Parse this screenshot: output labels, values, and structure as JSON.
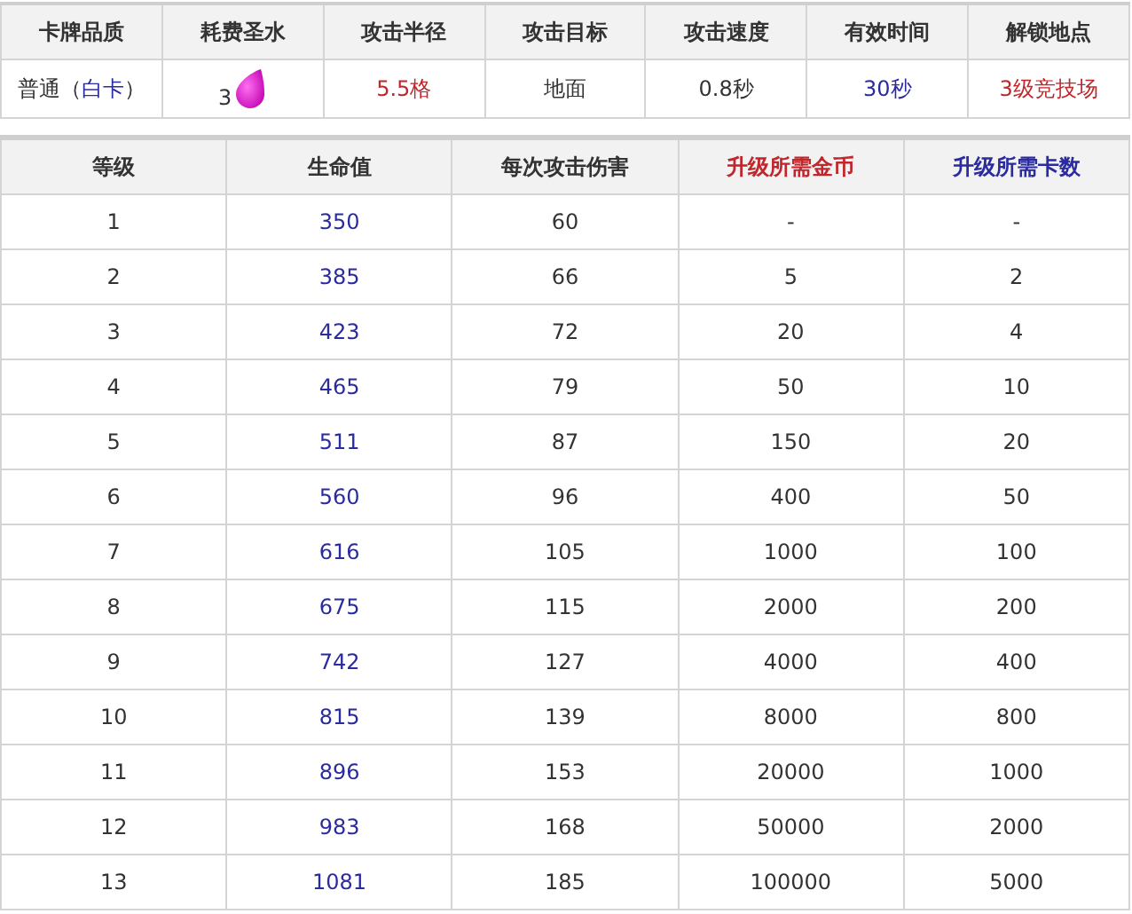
{
  "card_info": {
    "headers": [
      "卡牌品质",
      "耗费圣水",
      "攻击半径",
      "攻击目标",
      "攻击速度",
      "有效时间",
      "解锁地点"
    ],
    "quality": {
      "before": "普通（",
      "highlight": "白卡",
      "after": "）"
    },
    "cost": "3",
    "stats": [
      {
        "text": "5.5格",
        "color": "#c0262b"
      },
      {
        "text": "地面",
        "color": "#333333"
      },
      {
        "text": "0.8秒",
        "color": "#333333"
      },
      {
        "text": "30秒",
        "color": "#2b2ba0"
      },
      {
        "text": "3级竞技场",
        "color": "#c0262b"
      }
    ]
  },
  "levels": {
    "columns": [
      {
        "label": "等级",
        "color": "#333333"
      },
      {
        "label": "生命值",
        "color": "#333333"
      },
      {
        "label": "每次攻击伤害",
        "color": "#333333"
      },
      {
        "label": "升级所需金币",
        "color": "#c0262b"
      },
      {
        "label": "升级所需卡数",
        "color": "#2b2ba0"
      }
    ],
    "rows": [
      [
        "1",
        "350",
        "60",
        "-",
        "-"
      ],
      [
        "2",
        "385",
        "66",
        "5",
        "2"
      ],
      [
        "3",
        "423",
        "72",
        "20",
        "4"
      ],
      [
        "4",
        "465",
        "79",
        "50",
        "10"
      ],
      [
        "5",
        "511",
        "87",
        "150",
        "20"
      ],
      [
        "6",
        "560",
        "96",
        "400",
        "50"
      ],
      [
        "7",
        "616",
        "105",
        "1000",
        "100"
      ],
      [
        "8",
        "675",
        "115",
        "2000",
        "200"
      ],
      [
        "9",
        "742",
        "127",
        "4000",
        "400"
      ],
      [
        "10",
        "815",
        "139",
        "8000",
        "800"
      ],
      [
        "11",
        "896",
        "153",
        "20000",
        "1000"
      ],
      [
        "12",
        "983",
        "168",
        "50000",
        "2000"
      ],
      [
        "13",
        "1081",
        "185",
        "100000",
        "5000"
      ]
    ]
  }
}
